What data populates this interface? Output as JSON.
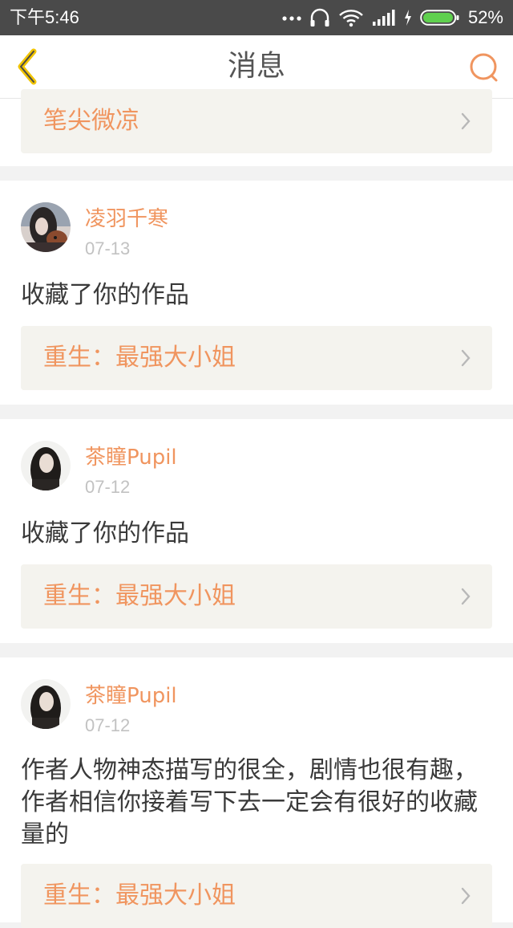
{
  "status_bar": {
    "time": "下午5:46",
    "battery_percent": "52%",
    "icons": [
      "more-dots-icon",
      "headphones-icon",
      "wifi-icon",
      "signal-icon",
      "charging-icon",
      "battery-icon"
    ]
  },
  "header": {
    "title": "消息",
    "back_icon": "chevron-left-icon",
    "search_icon": "search-icon",
    "accent_color": "#f0955f"
  },
  "partial_card": {
    "work_title": "笔尖微凉"
  },
  "messages": [
    {
      "user": "凌羽千寒",
      "date": "07-13",
      "text": "收藏了你的作品",
      "work_title": "重生：最强大小姐"
    },
    {
      "user": "茶瞳Pupil",
      "date": "07-12",
      "text": "收藏了你的作品",
      "work_title": "重生：最强大小姐"
    },
    {
      "user": "茶瞳Pupil",
      "date": "07-12",
      "text": "作者人物神态描写的很全，剧情也很有趣，作者相信你接着写下去一定会有很好的收藏量的",
      "work_title": "重生：最强大小姐"
    }
  ]
}
